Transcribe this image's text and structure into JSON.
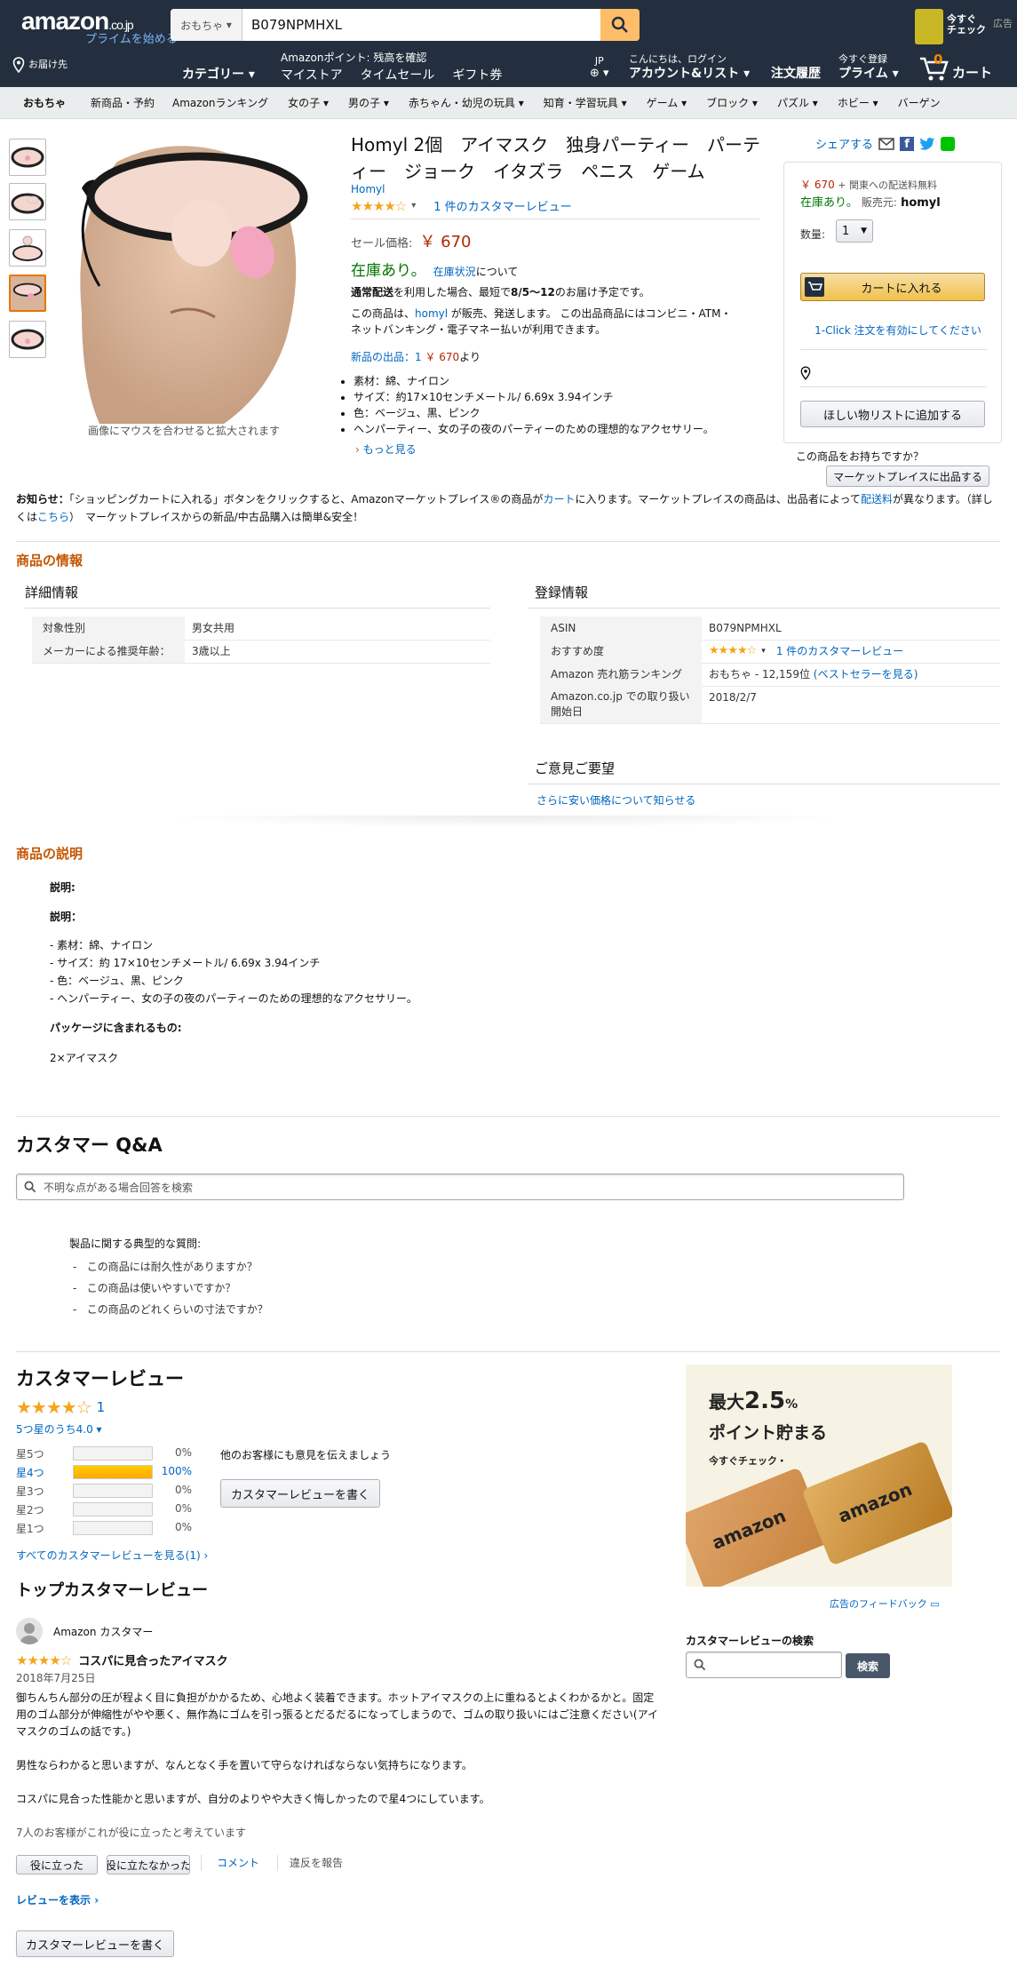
{
  "header": {
    "logo": "amazon",
    "logo_suffix": ".co.jp",
    "prime_link": "プライムを始める",
    "search_category": "おもちゃ",
    "search_value": "B079NPMHXL",
    "deliver_to": "お届け先",
    "category_label": "カテゴリー",
    "points_line1": "Amazonポイント: 残高を確認",
    "nav_links": [
      "マイストア",
      "タイムセール",
      "ギフト券"
    ],
    "lang": "JP",
    "greeting": "こんにちは、ログイン",
    "account": "アカウント&リスト",
    "orders": "注文履歴",
    "prime_line1": "今すぐ登録",
    "prime_line2": "プライム",
    "cart_count": "0",
    "cart_label": "カート",
    "ad_now": "今すぐ",
    "ad_check": "チェック",
    "ad_tag": "広告"
  },
  "subnav": [
    "おもちゃ",
    "新商品・予約",
    "Amazonランキング",
    "女の子",
    "男の子",
    "赤ちゃん・幼児の玩具",
    "知育・学習玩具",
    "ゲーム",
    "ブロック",
    "パズル",
    "ホビー",
    "バーゲン"
  ],
  "product": {
    "zoom_hint": "画像にマウスを合わせると拡大されます",
    "title": "Homyl 2個　アイマスク　独身パーティー　パーティー　ジョーク　イタズラ　ペニス　ゲーム",
    "brand": "Homyl",
    "rating_stars": "★★★★☆",
    "review_link": "1 件のカスタマーレビュー",
    "sale_label": "セール価格:",
    "price": "￥ 670",
    "instock": "在庫あり。",
    "stock_status_link": "在庫状況",
    "stock_status_suffix": "について",
    "delivery_prefix": "通常配送",
    "delivery_mid": "を利用した場合、最短で",
    "delivery_date": "8/5〜12",
    "delivery_suffix": "のお届け予定です。",
    "sold_by_pre": "この商品は、",
    "sold_by": "homyl",
    "sold_by_post": " が販売、発送します。 この出品商品にはコンビニ・ATM・ネットバンキング・電子マネー払いが利用できます。",
    "new_offers_label": "新品の出品：1",
    "new_offers_price": "￥ 670",
    "new_offers_suffix": "より",
    "bullets": [
      "素材：綿、ナイロン",
      "サイズ：約17×10センチメートル/ 6.69x 3.94インチ",
      "色：ベージュ、黒、ピンク",
      "ヘンパーティー、女の子の夜のパーティーのための理想的なアクセサリー。"
    ],
    "more": "もっと見る"
  },
  "buybox": {
    "share": "シェアする",
    "price": "￥ 670",
    "shipping": "+ 関東への配送料無料",
    "instock": "在庫あり。",
    "seller_label": "販売元:",
    "seller": "homyl",
    "qty_label": "数量:",
    "qty": "1",
    "add_to_cart": "カートに入れる",
    "one_click": "1-Click 注文を有効にしてください",
    "wishlist": "ほしい物リストに追加する",
    "have_one": "この商品をお持ちですか？",
    "sell": "マーケットプレイスに出品する"
  },
  "notice": {
    "label": "お知らせ：",
    "text1": "「ショッピングカートに入れる」ボタンをクリックすると、Amazonマーケットプレイス®の商品が",
    "cart_link": "カート",
    "text2": "に入ります。マーケットプレイスの商品は、出品者によって",
    "fee_link": "配送料",
    "text3": "が異なります。（詳しくは",
    "here_link": "こちら",
    "text4": "）　マーケットプレイスからの新品/中古品購入は簡単&安全！"
  },
  "info": {
    "title": "商品の情報",
    "details_title": "詳細情報",
    "details": [
      {
        "k": "対象性別",
        "v": "男女共用"
      },
      {
        "k": "メーカーによる推奨年齢：",
        "v": "3歳以上"
      }
    ],
    "reg_title": "登録情報",
    "asin_label": "ASIN",
    "asin": "B079NPMHXL",
    "recommend_label": "おすすめ度",
    "recommend_stars": "★★★★☆",
    "recommend_link": "1 件のカスタマーレビュー",
    "rank_label": "Amazon 売れ筋ランキング",
    "rank": "おもちゃ - 12,159位",
    "rank_link": "(ベストセラーを見る)",
    "date_label": "Amazon.co.jp での取り扱い開始日",
    "date": "2018/2/7",
    "feedback_title": "ご意見ご要望",
    "feedback_link": "さらに安い価格について知らせる"
  },
  "description": {
    "title": "商品の説明",
    "h1": "説明:",
    "h2": "説明：",
    "lines": [
      "- 素材：綿、ナイロン",
      "- サイズ：約 17×10センチメートル/ 6.69x 3.94インチ",
      "- 色：ベージュ、黒、ピンク",
      "- ヘンパーティー、女の子の夜のパーティーのための理想的なアクセサリー。"
    ],
    "pkg_title": "パッケージに含まれるもの:",
    "pkg": "2×アイマスク"
  },
  "qa": {
    "title": "カスタマー Q&A",
    "placeholder": "不明な点がある場合回答を検索",
    "typical": "製品に関する典型的な質問:",
    "questions": [
      "この商品には耐久性がありますか？",
      "この商品は使いやすいですか？",
      "この商品のどれくらいの寸法ですか？"
    ]
  },
  "reviews": {
    "title": "カスタマーレビュー",
    "stars": "★★★★☆",
    "count": "1",
    "avg": "5つ星のうち4.0",
    "rows": [
      {
        "label": "星5つ",
        "pct": "0%",
        "fill": 0
      },
      {
        "label": "星4つ",
        "pct": "100%",
        "fill": 1
      },
      {
        "label": "星3つ",
        "pct": "0%",
        "fill": 0
      },
      {
        "label": "星2つ",
        "pct": "0%",
        "fill": 0
      },
      {
        "label": "星1つ",
        "pct": "0%",
        "fill": 0
      }
    ],
    "share_prompt": "他のお客様にも意見を伝えましょう",
    "write": "カスタマーレビューを書く",
    "see_all": "すべてのカスタマーレビューを見る(1)",
    "top_title": "トップカスタマーレビュー",
    "reviewer": "Amazon カスタマー",
    "r_stars": "★★★★☆",
    "r_title": "コスパに見合ったアイマスク",
    "r_date": "2018年7月25日",
    "r_body1": "御ちんちん部分の圧が程よく目に負担がかかるため、心地よく装着できます。ホットアイマスクの上に重ねるとよくわかるかと。固定用のゴム部分が伸縮性がやや悪く、無作為にゴムを引っ張るとだるだるになってしまうので、ゴムの取り扱いにはご注意ください(アイマスクのゴムの話です。)",
    "r_body2": "男性ならわかると思いますが、なんとなく手を置いて守らなければならない気持ちになります。",
    "r_body3": "コスパに見合った性能かと思いますが、自分のよりやや大きく悔しかったので星4つにしています。",
    "helpful": "7人のお客様がこれが役に立ったと考えています",
    "yes": "役に立った",
    "no": "役に立たなかった",
    "comment": "コメント",
    "report": "違反を報告",
    "more_reviews": "レビューを表示",
    "write2": "カスタマーレビューを書く"
  },
  "ad": {
    "big": "最大",
    "pct": "2.5",
    "pct_sign": "%",
    "line2": "ポイント貯まる",
    "check": "今すぐチェック・",
    "card": "amazon",
    "feedback": "広告のフィードバック",
    "search_title": "カスタマーレビューの検索",
    "search_btn": "検索"
  }
}
